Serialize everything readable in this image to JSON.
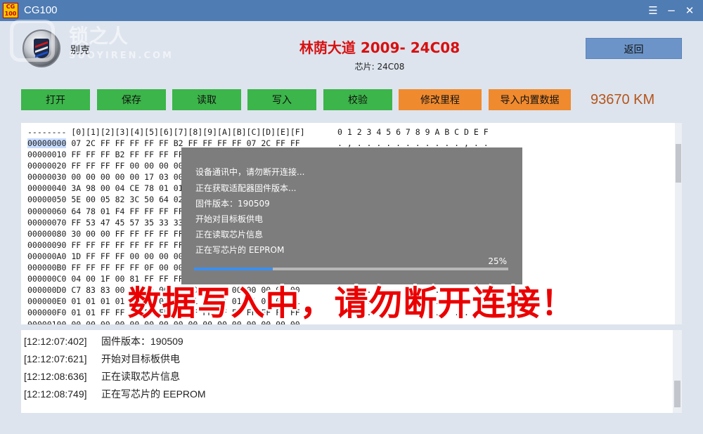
{
  "window": {
    "title": "CG100",
    "logo_text": "CG\n100"
  },
  "watermark": {
    "cn": "锁之人",
    "en": "SUOYIREN.COM"
  },
  "brand": {
    "name": "别克"
  },
  "vehicle": {
    "model": "林荫大道 2009- 24C08",
    "chip": "芯片: 24C08"
  },
  "buttons": {
    "back": "返回",
    "open": "打开",
    "save": "保存",
    "read": "读取",
    "write": "写入",
    "verify": "校验",
    "edit_mileage": "修改里程",
    "import_data": "导入内置数据"
  },
  "mileage": "93670 KM",
  "hex": {
    "header": "-------- [0][1][2][3][4][5][6][7][8][9][A][B][C][D][E][F]",
    "ascii_header": "0 1 2 3 4 5 6 7 8 9 A B C D E F",
    "selected_address": "00000000",
    "rows": [
      {
        "addr": "00000000",
        "data": " 07 2C FF FF FF FF FF B2 FF FF FF FF 07 2C FF FF"
      },
      {
        "addr": "00000010",
        "data": " FF FF FF B2 FF FF FF FF"
      },
      {
        "addr": "00000020",
        "data": " FF FF FF FF 00 00 00 00"
      },
      {
        "addr": "00000030",
        "data": " 00 00 00 00 00 17 03 00"
      },
      {
        "addr": "00000040",
        "data": " 3A 98 00 04 CE 78 01 01"
      },
      {
        "addr": "00000050",
        "data": " 5E 00 05 82 3C 50 64 02"
      },
      {
        "addr": "00000060",
        "data": " 64 78 01 F4 FF FF FF FF"
      },
      {
        "addr": "00000070",
        "data": " FF 53 47 45 57 35 33 33"
      },
      {
        "addr": "00000080",
        "data": " 30 00 00 FF FF FF FF FF"
      },
      {
        "addr": "00000090",
        "data": " FF FF FF FF FF FF FF FF"
      },
      {
        "addr": "000000A0",
        "data": " 1D FF FF FF 00 00 00 00"
      },
      {
        "addr": "000000B0",
        "data": " FF FF FF FF FF 0F 00 00"
      },
      {
        "addr": "000000C0",
        "data": " 04 00 1F 00 81 FF FF FF"
      },
      {
        "addr": "000000D0",
        "data": " C7 83 83 00 00 00 00 00 00 83 00 00 00 00 00 00"
      },
      {
        "addr": "000000E0",
        "data": " 01 01 01 01 01 01 01 01 01 01 01 01 01 01 01 01"
      },
      {
        "addr": "000000F0",
        "data": " 01 01 FF FF FF FF FF FF FF FF FF FF FF FF FF FF"
      },
      {
        "addr": "00000100",
        "data": " 00 00 00 00 00 00 00 00 00 00 00 00 00 00 00 00"
      }
    ],
    "ascii_rows": [
      ". , . . . . . . . . . . . , . .",
      "",
      "",
      "",
      "",
      "",
      "",
      "",
      "",
      "",
      "",
      "",
      "",
      ". . . . . . . . . . . . . . . .",
      ". . . . . . . . . . . . . . . .",
      ". . . . . . . . . . . . . . . .",
      ". . . . . . . . . . . . . . . ."
    ]
  },
  "dialog": {
    "lines": [
      "设备通讯中，请勿断开连接...",
      "正在获取适配器固件版本...",
      "固件版本：190509",
      "开始对目标板供电",
      "正在读取芯片信息",
      "正在写芯片的   EEPROM"
    ],
    "progress": 25,
    "progress_label": "25%"
  },
  "overlay_warning": "数据写入中，请勿断开连接！",
  "log": [
    {
      "time": "[12:12:07:402]",
      "msg": "固件版本：190509"
    },
    {
      "time": "[12:12:07:621]",
      "msg": "开始对目标板供电"
    },
    {
      "time": "[12:12:08:636]",
      "msg": "正在读取芯片信息"
    },
    {
      "time": "[12:12:08:749]",
      "msg": "正在写芯片的   EEPROM"
    }
  ]
}
